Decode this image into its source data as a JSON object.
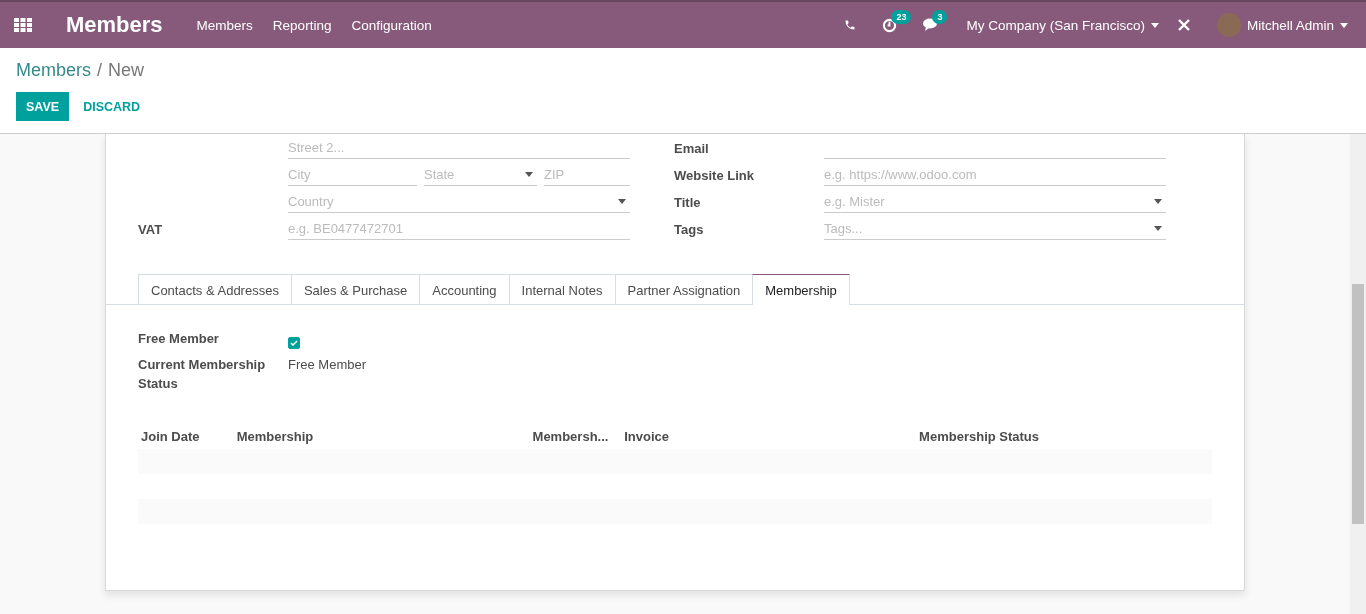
{
  "navbar": {
    "app_title": "Members",
    "menu": [
      "Members",
      "Reporting",
      "Configuration"
    ],
    "activity_count": "23",
    "message_count": "3",
    "company": "My Company (San Francisco)",
    "user": "Mitchell Admin"
  },
  "breadcrumb_separator": "/",
  "breadcrumb": [
    {
      "label": "Members",
      "kind": "link"
    },
    {
      "label": "New",
      "kind": "current"
    }
  ],
  "buttons": [
    {
      "label": "SAVE",
      "kind": "primary"
    },
    {
      "label": "DISCARD",
      "kind": "link"
    }
  ],
  "address": {
    "street2": {
      "placeholder": "Street 2..."
    },
    "city": {
      "placeholder": "City"
    },
    "state": {
      "placeholder": "State"
    },
    "zip": {
      "placeholder": "ZIP"
    },
    "country": {
      "placeholder": "Country"
    },
    "vat": {
      "label": "VAT",
      "placeholder": "e.g. BE0477472701"
    }
  },
  "contact_fields": [
    {
      "label": "Email",
      "kind": "text"
    },
    {
      "label": "Website Link",
      "kind": "text",
      "placeholder": "e.g. https://www.odoo.com"
    },
    {
      "label": "Title",
      "kind": "select",
      "placeholder": "e.g. Mister"
    },
    {
      "label": "Tags",
      "kind": "select",
      "placeholder": "Tags..."
    }
  ],
  "tabs": [
    {
      "label": "Contacts & Addresses",
      "selected": false
    },
    {
      "label": "Sales & Purchase",
      "selected": false
    },
    {
      "label": "Accounting",
      "selected": false
    },
    {
      "label": "Internal Notes",
      "selected": false
    },
    {
      "label": "Partner Assignation",
      "selected": false
    },
    {
      "label": "Membership",
      "selected": true
    }
  ],
  "membership": {
    "free_member": {
      "label": "Free Member",
      "checked": true
    },
    "status": {
      "label": "Current Membership Status",
      "value": "Free Member"
    }
  },
  "table": {
    "columns": [
      "Join Date",
      "Membership",
      "Membersh...",
      "Invoice",
      "Membership Status"
    ]
  }
}
